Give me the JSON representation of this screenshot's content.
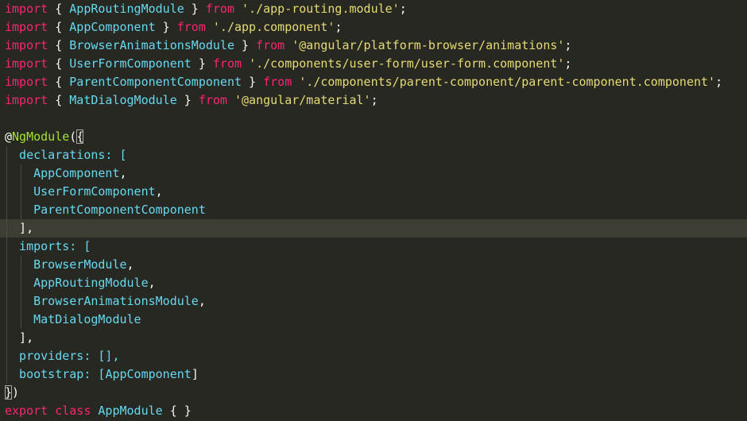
{
  "editor": {
    "lines": [
      [
        {
          "t": "import",
          "c": "kw"
        },
        {
          "t": " { ",
          "c": "pun"
        },
        {
          "t": "AppRoutingModule",
          "c": "cls"
        },
        {
          "t": " } ",
          "c": "pun"
        },
        {
          "t": "from",
          "c": "kw"
        },
        {
          "t": " ",
          "c": "pun"
        },
        {
          "t": "'./app-routing.module'",
          "c": "str"
        },
        {
          "t": ";",
          "c": "pun"
        }
      ],
      [
        {
          "t": "import",
          "c": "kw"
        },
        {
          "t": " { ",
          "c": "pun"
        },
        {
          "t": "AppComponent",
          "c": "cls"
        },
        {
          "t": " } ",
          "c": "pun"
        },
        {
          "t": "from",
          "c": "kw"
        },
        {
          "t": " ",
          "c": "pun"
        },
        {
          "t": "'./app.component'",
          "c": "str"
        },
        {
          "t": ";",
          "c": "pun"
        }
      ],
      [
        {
          "t": "import",
          "c": "kw"
        },
        {
          "t": " { ",
          "c": "pun"
        },
        {
          "t": "BrowserAnimationsModule",
          "c": "cls"
        },
        {
          "t": " } ",
          "c": "pun"
        },
        {
          "t": "from",
          "c": "kw"
        },
        {
          "t": " ",
          "c": "pun"
        },
        {
          "t": "'@angular/platform-browser/animations'",
          "c": "str"
        },
        {
          "t": ";",
          "c": "pun"
        }
      ],
      [
        {
          "t": "import",
          "c": "kw"
        },
        {
          "t": " { ",
          "c": "pun"
        },
        {
          "t": "UserFormComponent",
          "c": "cls"
        },
        {
          "t": " } ",
          "c": "pun"
        },
        {
          "t": "from",
          "c": "kw"
        },
        {
          "t": " ",
          "c": "pun"
        },
        {
          "t": "'./components/user-form/user-form.component'",
          "c": "str"
        },
        {
          "t": ";",
          "c": "pun"
        }
      ],
      [
        {
          "t": "import",
          "c": "kw"
        },
        {
          "t": " { ",
          "c": "pun"
        },
        {
          "t": "ParentComponentComponent",
          "c": "cls"
        },
        {
          "t": " } ",
          "c": "pun"
        },
        {
          "t": "from",
          "c": "kw"
        },
        {
          "t": " ",
          "c": "pun"
        },
        {
          "t": "'./components/parent-component/parent-component.component'",
          "c": "str"
        },
        {
          "t": ";",
          "c": "pun"
        }
      ],
      [
        {
          "t": "import",
          "c": "kw"
        },
        {
          "t": " { ",
          "c": "pun"
        },
        {
          "t": "MatDialogModule",
          "c": "cls"
        },
        {
          "t": " } ",
          "c": "pun"
        },
        {
          "t": "from",
          "c": "kw"
        },
        {
          "t": " ",
          "c": "pun"
        },
        {
          "t": "'@angular/material'",
          "c": "str"
        },
        {
          "t": ";",
          "c": "pun"
        }
      ],
      [],
      [
        {
          "t": "@",
          "c": "pun"
        },
        {
          "t": "NgModule",
          "c": "fn"
        },
        {
          "t": "(",
          "c": "pun"
        },
        {
          "t": "{",
          "c": "pun",
          "m": 1
        }
      ],
      [
        {
          "t": "  declarations: [",
          "c": "cls"
        }
      ],
      [
        {
          "t": "    AppComponent",
          "c": "cls"
        },
        {
          "t": ",",
          "c": "pun"
        }
      ],
      [
        {
          "t": "    UserFormComponent",
          "c": "cls"
        },
        {
          "t": ",",
          "c": "pun"
        }
      ],
      [
        {
          "t": "    ParentComponentComponent",
          "c": "cls"
        }
      ],
      [
        {
          "t": "  ],",
          "c": "pun"
        }
      ],
      [
        {
          "t": "  imports: [",
          "c": "cls"
        }
      ],
      [
        {
          "t": "    BrowserModule",
          "c": "cls"
        },
        {
          "t": ",",
          "c": "pun"
        }
      ],
      [
        {
          "t": "    AppRoutingModule",
          "c": "cls"
        },
        {
          "t": ",",
          "c": "pun"
        }
      ],
      [
        {
          "t": "    BrowserAnimationsModule",
          "c": "cls"
        },
        {
          "t": ",",
          "c": "pun"
        }
      ],
      [
        {
          "t": "    MatDialogModule",
          "c": "cls"
        }
      ],
      [
        {
          "t": "  ],",
          "c": "pun"
        }
      ],
      [
        {
          "t": "  providers: [],",
          "c": "cls"
        }
      ],
      [
        {
          "t": "  bootstrap: [",
          "c": "cls"
        },
        {
          "t": "AppComponent",
          "c": "cls"
        },
        {
          "t": "]",
          "c": "pun"
        }
      ],
      [
        {
          "t": "}",
          "c": "pun",
          "m": 1
        },
        {
          "t": ")",
          "c": "pun"
        }
      ],
      [
        {
          "t": "export",
          "c": "kw"
        },
        {
          "t": " ",
          "c": "pun"
        },
        {
          "t": "class",
          "c": "kw"
        },
        {
          "t": " ",
          "c": "pun"
        },
        {
          "t": "AppModule",
          "c": "cls"
        },
        {
          "t": " { }",
          "c": "pun"
        }
      ]
    ],
    "current_line_index": 12
  },
  "colors": {
    "background": "#272822",
    "keyword": "#f92672",
    "class": "#66d9ef",
    "string": "#e6db74",
    "punctuation": "#f8f8f2",
    "decorator": "#a6e22e"
  }
}
